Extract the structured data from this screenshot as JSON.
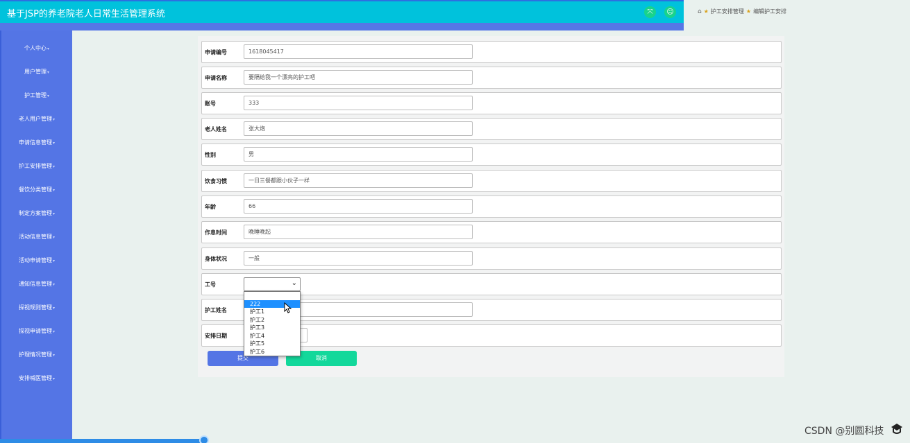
{
  "header": {
    "title": "基于JSP的养老院老人日常生活管理系统"
  },
  "breadcrumb": [
    "护工安排管理",
    "编辑护工安排"
  ],
  "sidebar": {
    "items": [
      {
        "label": "个人中心"
      },
      {
        "label": "用户管理"
      },
      {
        "label": "护工管理"
      },
      {
        "label": "老人用户管理"
      },
      {
        "label": "申请信息管理"
      },
      {
        "label": "护工安排管理"
      },
      {
        "label": "餐饮分类管理"
      },
      {
        "label": "制定方案管理"
      },
      {
        "label": "活动信息管理"
      },
      {
        "label": "活动申请管理"
      },
      {
        "label": "通知信息管理"
      },
      {
        "label": "探视规则管理"
      },
      {
        "label": "探视申请管理"
      },
      {
        "label": "护理情况管理"
      },
      {
        "label": "安排喊医管理"
      }
    ]
  },
  "form": {
    "fields": [
      {
        "label": "申请编号",
        "value": "1618045417"
      },
      {
        "label": "申请名称",
        "value": "要隔给我一个漂亮的护工吧"
      },
      {
        "label": "账号",
        "value": "333"
      },
      {
        "label": "老人姓名",
        "value": "张大炮"
      },
      {
        "label": "性别",
        "value": "男"
      },
      {
        "label": "饮食习惯",
        "value": "一日三餐都跟小伙子一样"
      },
      {
        "label": "年龄",
        "value": "66"
      },
      {
        "label": "作息时间",
        "value": "晚睡晚起"
      },
      {
        "label": "身体状况",
        "value": "一般"
      }
    ],
    "worker_id": {
      "label": "工号",
      "selected": ""
    },
    "worker_name": {
      "label": "护工姓名",
      "value": ""
    },
    "schedule_date": {
      "label": "安排日期",
      "value": ""
    },
    "submit_label": "提交",
    "cancel_label": "取消"
  },
  "dropdown": {
    "options": [
      "",
      "222",
      "护工1",
      "护工2",
      "护工3",
      "护工4",
      "护工5",
      "护工6"
    ],
    "highlighted": "222"
  },
  "watermark": "CSDN @别圆科技",
  "colors": {
    "header": "#00c2dc",
    "sidebar": "#5475e5",
    "accent_green": "#13d89b",
    "option_highlight": "#1e90ff"
  }
}
